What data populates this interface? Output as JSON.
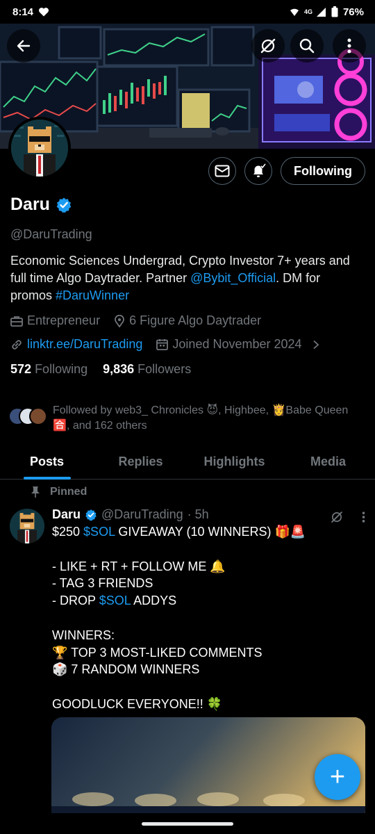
{
  "status_bar": {
    "time": "8:14",
    "network": "4G",
    "battery": "76%"
  },
  "profile": {
    "display_name": "Daru",
    "handle": "@DaruTrading",
    "bio_part1": "Economic Sciences Undergrad, Crypto Investor 7+ years and full time Algo Daytrader. Partner ",
    "bio_mention": "@Bybit_Official",
    "bio_part2": ". DM for promos ",
    "bio_hashtag": "#DaruWinner",
    "category": "Entrepreneur",
    "location": "6 Figure Algo Daytrader",
    "website": "linktr.ee/DaruTrading",
    "joined": "Joined November 2024",
    "following_count": "572",
    "following_label": "Following",
    "followers_count": "9,836",
    "followers_label": "Followers",
    "following_button": "Following",
    "followed_by_text": "Followed by web3_ Chronicles 😈, Highbee, 👸Babe Queen 🈴, and 162 others"
  },
  "tabs": [
    "Posts",
    "Replies",
    "Highlights",
    "Media"
  ],
  "active_tab": "Posts",
  "pinned_post": {
    "pinned_label": "Pinned",
    "author": "Daru",
    "handle": "@DaruTrading",
    "time": "· 5h",
    "line1_a": "$250 ",
    "line1_cashtag": "$SOL",
    "line1_b": " GIVEAWAY (10 WINNERS) 🎁🚨",
    "line2": "- LIKE + RT + FOLLOW ME 🔔",
    "line3": "- TAG 3 FRIENDS",
    "line4_a": "- DROP ",
    "line4_cashtag": "$SOL",
    "line4_b": " ADDYS",
    "line5": "WINNERS:",
    "line6": "🏆 TOP 3 MOST-LIKED COMMENTS",
    "line7": "🎲 7 RANDOM WINNERS",
    "line8": "GOODLUCK EVERYONE!! 🍀"
  },
  "fab": {
    "label": "+"
  },
  "colors": {
    "background": "#000000",
    "accent": "#1d9bf0",
    "muted_text": "#71767b",
    "primary_text": "#e7e9ea",
    "border": "#2f3336"
  },
  "icons": [
    "heart-icon",
    "wifi-icon",
    "signal-icon",
    "battery-icon",
    "back-arrow-icon",
    "grok-icon",
    "search-icon",
    "more-vertical-icon",
    "message-icon",
    "notification-bell-icon",
    "verified-badge-icon",
    "briefcase-icon",
    "location-icon",
    "link-icon",
    "calendar-icon",
    "chevron-right-icon",
    "pin-icon",
    "plus-icon"
  ]
}
